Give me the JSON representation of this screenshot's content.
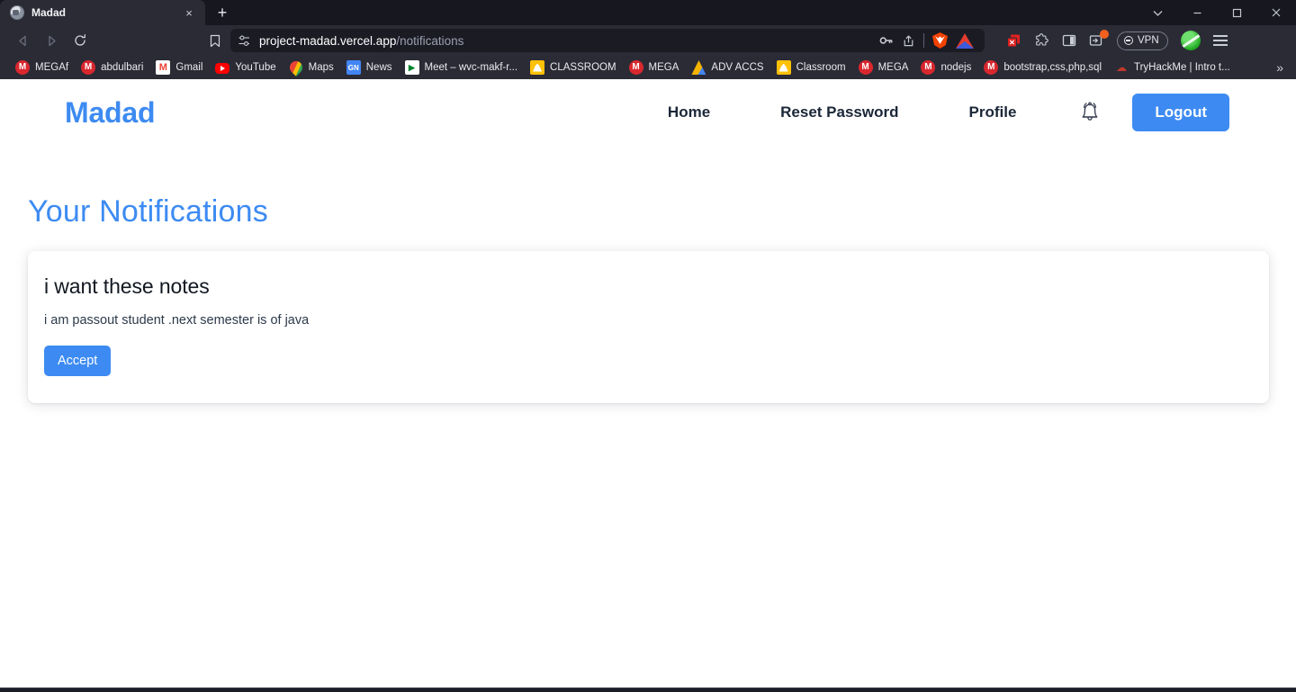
{
  "browser": {
    "tab": {
      "title": "Madad",
      "close_label": "×",
      "favicon": "globe-favicon"
    },
    "new_tab_label": "+",
    "window_controls": {
      "minimize": "–",
      "maximize": "❐",
      "close": "✕",
      "tab_search": "⌄"
    },
    "nav": {
      "back": "◁",
      "forward": "▷",
      "reload": "↻",
      "bookmark": "bookmark-icon"
    },
    "url": {
      "host": "project-madad.vercel.app",
      "path": "/notifications",
      "site_settings_icon": "sliders-icon",
      "actions": [
        "key-icon",
        "share-icon",
        "brave-shields-icon",
        "extension-triangle-icon"
      ]
    },
    "toolbar_right": {
      "vpn_label": "VPN",
      "icons": [
        "close-extension-icon",
        "puzzle-extension-icon",
        "sidebar-panel-icon",
        "split-window-icon"
      ],
      "menu": "hamburger-menu-icon"
    },
    "bookmarks": [
      {
        "label": "MEGAf",
        "icon": "mega"
      },
      {
        "label": "abdulbari",
        "icon": "mega"
      },
      {
        "label": "Gmail",
        "icon": "gmail"
      },
      {
        "label": "YouTube",
        "icon": "youtube"
      },
      {
        "label": "Maps",
        "icon": "maps"
      },
      {
        "label": "News",
        "icon": "news"
      },
      {
        "label": "Meet – wvc-makf-r...",
        "icon": "meet"
      },
      {
        "label": "CLASSROOM",
        "icon": "classroom"
      },
      {
        "label": "MEGA",
        "icon": "mega"
      },
      {
        "label": "ADV ACCS",
        "icon": "drive"
      },
      {
        "label": "Classroom",
        "icon": "classroom"
      },
      {
        "label": "MEGA",
        "icon": "mega"
      },
      {
        "label": "nodejs",
        "icon": "mega"
      },
      {
        "label": "bootstrap,css,php,sql",
        "icon": "mega"
      },
      {
        "label": "TryHackMe | Intro t...",
        "icon": "thm"
      }
    ],
    "bookmarks_overflow": "»"
  },
  "site": {
    "brand": "Madad",
    "nav_links": [
      {
        "label": "Home"
      },
      {
        "label": "Reset Password"
      },
      {
        "label": "Profile"
      }
    ],
    "bell_icon": "notification-bell-icon",
    "logout_label": "Logout"
  },
  "main": {
    "page_title": "Your Notifications",
    "notifications": [
      {
        "title": "i want these notes",
        "body": "i am passout student .next semester is of java",
        "action_label": "Accept"
      }
    ]
  },
  "colors": {
    "accent": "#3d8bf2",
    "chrome_bg": "#2b2b36",
    "tabstrip_bg": "#17171f",
    "page_bg": "#ffffff",
    "text_dark": "#1b2738"
  }
}
